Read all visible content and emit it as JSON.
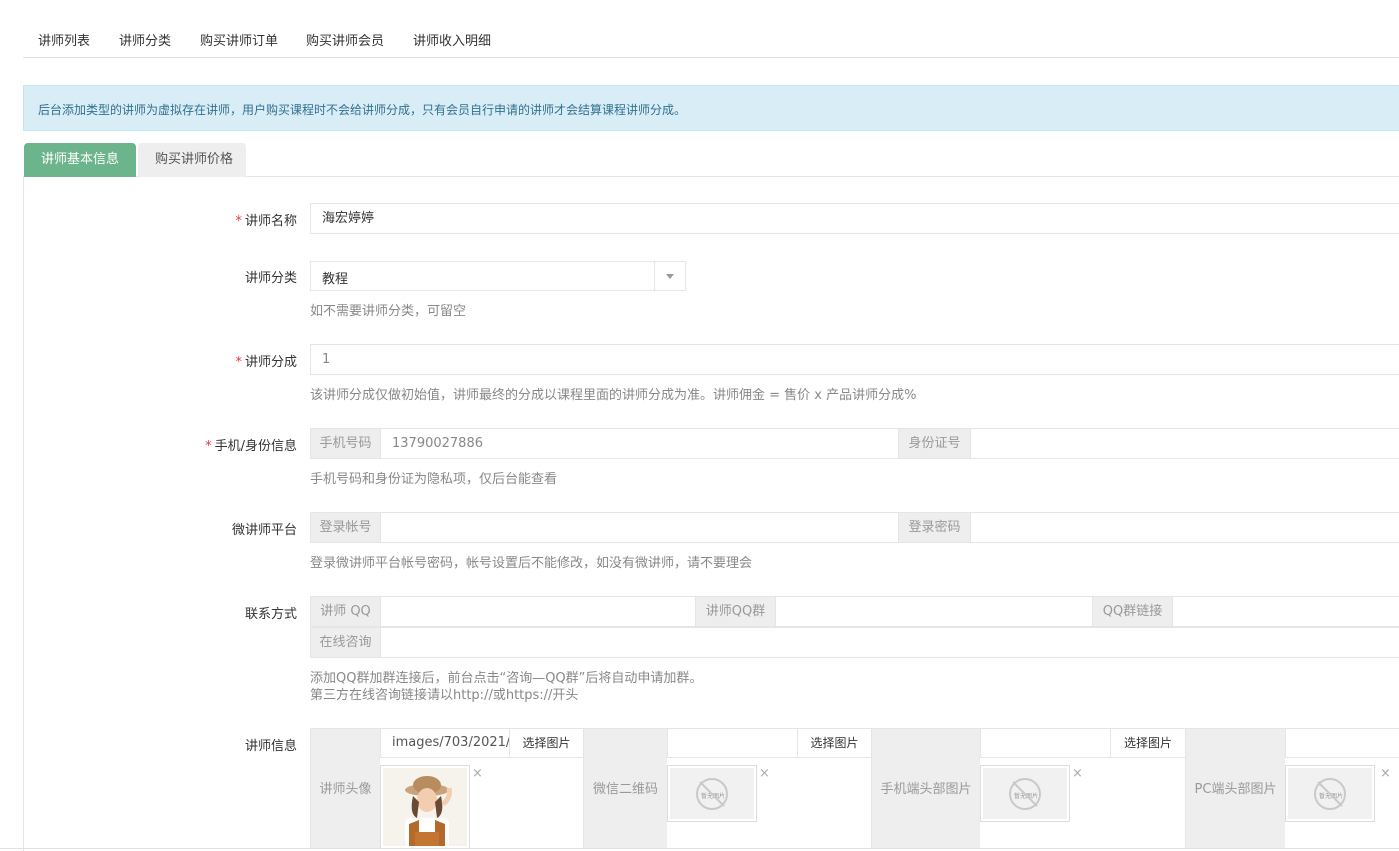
{
  "nav": [
    "讲师列表",
    "讲师分类",
    "购买讲师订单",
    "购买讲师会员",
    "讲师收入明细"
  ],
  "alert": "后台添加类型的讲师为虚拟存在讲师，用户购买课程时不会给讲师分成，只有会员自行申请的讲师才会结算课程讲师分成。",
  "tabs": {
    "basic": "讲师基本信息",
    "price": "购买讲师价格"
  },
  "form": {
    "name": {
      "label": "讲师名称",
      "value": "海宏婷婷"
    },
    "category": {
      "label": "讲师分类",
      "value": "教程",
      "hint": "如不需要讲师分类，可留空"
    },
    "commission": {
      "label": "讲师分成",
      "value": "1",
      "hint": "该讲师分成仅做初始值，讲师最终的分成以课程里面的讲师分成为准。讲师佣金 = 售价 x 产品讲师分成%"
    },
    "identity": {
      "label": "手机/身份信息",
      "phone_addon": "手机号码",
      "phone_value": "13790027886",
      "id_addon": "身份证号",
      "id_value": "",
      "hint": "手机号码和身份证为隐私项，仅后台能查看"
    },
    "wechat_platform": {
      "label": "微讲师平台",
      "account_addon": "登录帐号",
      "account_value": "",
      "password_addon": "登录密码",
      "password_value": "",
      "hint": "登录微讲师平台帐号密码，帐号设置后不能修改，如没有微讲师，请不要理会"
    },
    "contact": {
      "label": "联系方式",
      "qq_addon": "讲师 QQ",
      "qq_value": "",
      "qqgroup_addon": "讲师QQ群",
      "qqgroup_value": "",
      "qqlink_addon": "QQ群链接",
      "qqlink_value": "",
      "online_addon": "在线咨询",
      "online_value": "",
      "hint1": "添加QQ群加群连接后，前台点击“咨询—QQ群”后将自动申请加群。",
      "hint2": "第三方在线咨询链接请以http://或https://开头"
    },
    "info": {
      "label": "讲师信息",
      "choose_label": "选择图片",
      "noimg_text": "暂无图片",
      "close": "×",
      "avatar": {
        "addon": "讲师头像",
        "path": "images/703/2021/"
      },
      "wechat_qr": {
        "addon": "微信二维码",
        "path": ""
      },
      "mobile_head": {
        "addon": "手机端头部图片",
        "path": ""
      },
      "pc_head": {
        "addon": "PC端头部图片",
        "path": ""
      }
    }
  },
  "required_mark": "*"
}
